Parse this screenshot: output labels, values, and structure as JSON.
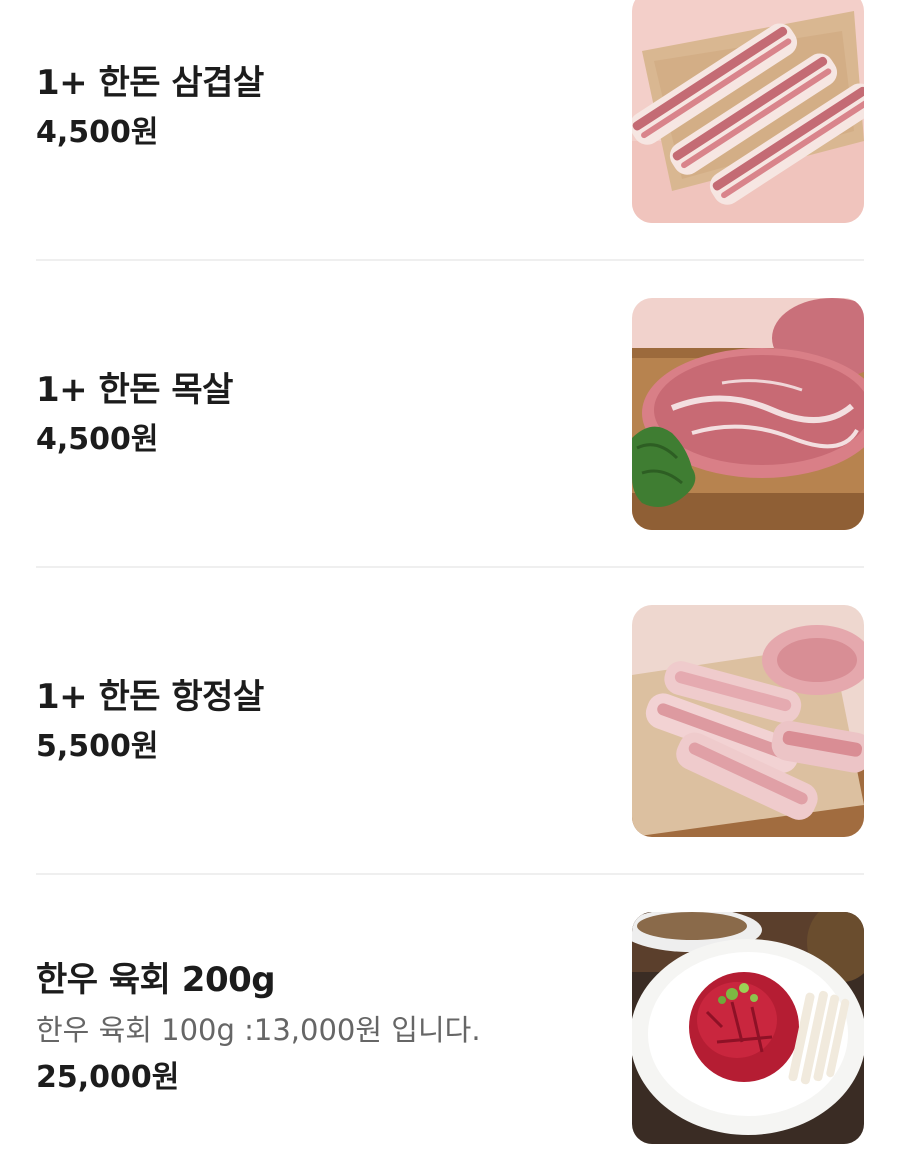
{
  "menu": {
    "items": [
      {
        "name": "1+ 한돈 삼겹살",
        "price": "4,500원",
        "image_icon": "pork-belly-photo"
      },
      {
        "name": "1+ 한돈 목살",
        "price": "4,500원",
        "image_icon": "pork-neck-photo"
      },
      {
        "name": "1+ 한돈 항정살",
        "price": "5,500원",
        "image_icon": "pork-jowl-photo"
      },
      {
        "name": "한우 육회 200g",
        "description": "한우 육회 100g :13,000원 입니다.",
        "price": "25,000원",
        "image_icon": "beef-tartare-photo"
      }
    ]
  }
}
